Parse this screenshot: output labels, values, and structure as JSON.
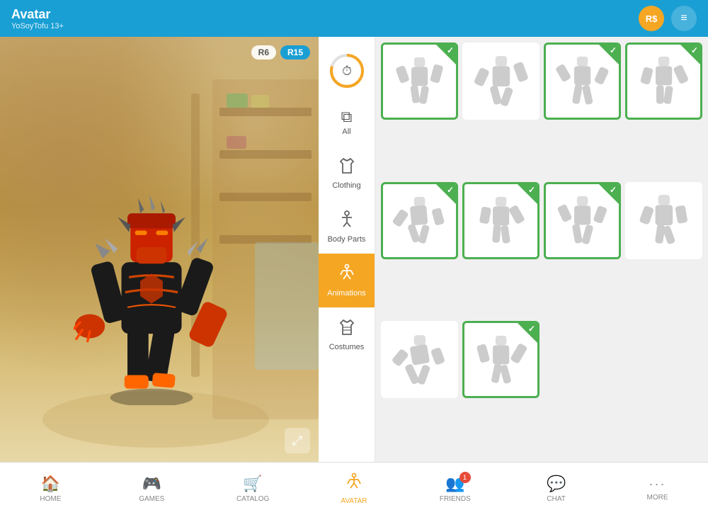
{
  "header": {
    "title": "Avatar",
    "subtitle": "YoSoyTofu 13+",
    "robux_label": "R$",
    "menu_icon": "≡"
  },
  "avatar_badges": {
    "r6": "R6",
    "r15": "R15"
  },
  "sidebar": {
    "items": [
      {
        "id": "recent",
        "label": "Recent",
        "icon": "🕐"
      },
      {
        "id": "all",
        "label": "All",
        "icon": "⊞"
      },
      {
        "id": "clothing",
        "label": "Clothing",
        "icon": "👕"
      },
      {
        "id": "body-parts",
        "label": "Body Parts",
        "icon": "🧍"
      },
      {
        "id": "animations",
        "label": "Animations",
        "icon": "🏃"
      },
      {
        "id": "costumes",
        "label": "Costumes",
        "icon": "👘"
      }
    ],
    "active": "animations"
  },
  "grid": {
    "items": [
      {
        "id": 1,
        "selected": true
      },
      {
        "id": 2,
        "selected": false
      },
      {
        "id": 3,
        "selected": true
      },
      {
        "id": 4,
        "selected": true
      },
      {
        "id": 5,
        "selected": true
      },
      {
        "id": 6,
        "selected": true
      },
      {
        "id": 7,
        "selected": true
      },
      {
        "id": 8,
        "selected": false
      },
      {
        "id": 9,
        "selected": false
      },
      {
        "id": 10,
        "selected": true
      }
    ]
  },
  "bottom_nav": {
    "items": [
      {
        "id": "home",
        "label": "HOME",
        "icon": "🏠",
        "active": false
      },
      {
        "id": "games",
        "label": "GAMES",
        "icon": "🎮",
        "active": false
      },
      {
        "id": "catalog",
        "label": "CATALOG",
        "icon": "🛒",
        "active": false
      },
      {
        "id": "avatar",
        "label": "AVATAR",
        "icon": "🏃",
        "active": true
      },
      {
        "id": "friends",
        "label": "FRIENDS",
        "icon": "👥",
        "active": false,
        "badge": "1"
      },
      {
        "id": "chat",
        "label": "CHAT",
        "icon": "💬",
        "active": false
      },
      {
        "id": "more",
        "label": "MORE",
        "icon": "···",
        "active": false
      }
    ]
  }
}
